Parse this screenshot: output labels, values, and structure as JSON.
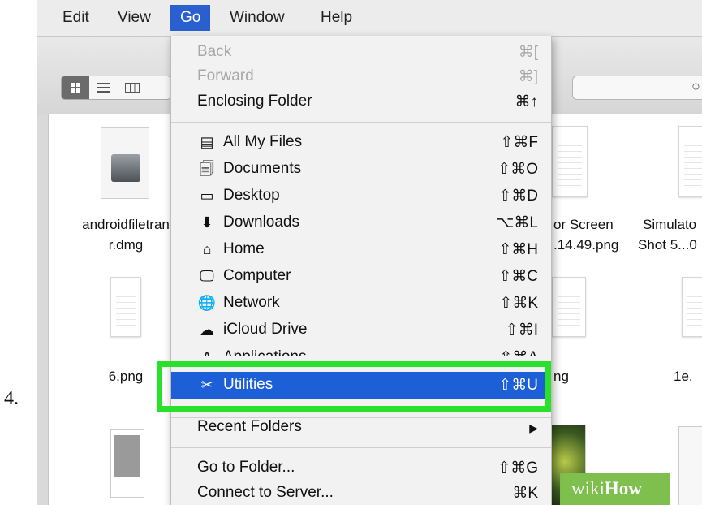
{
  "step_number": "4.",
  "menubar": {
    "items": [
      "Edit",
      "View",
      "Go",
      "Window",
      "Help"
    ],
    "active": "Go"
  },
  "toolbar": {
    "view_modes": [
      "icon-view",
      "list-view",
      "column-view"
    ],
    "search_icon": "search-icon"
  },
  "files": [
    {
      "caption_line1": "androidfiletran",
      "caption_line2": "r.dmg"
    },
    {
      "caption_line1": "or Screen",
      "caption_line2": ".14.49.png"
    },
    {
      "caption_line1": "Simulato",
      "caption_line2": "Shot 5...0"
    },
    {
      "caption_line1": "6.png",
      "caption_line2": ""
    },
    {
      "caption_line1": "ng",
      "caption_line2": ""
    },
    {
      "caption_line1": "1e.",
      "caption_line2": ""
    }
  ],
  "go_menu": {
    "back": {
      "label": "Back",
      "shortcut": "⌘["
    },
    "forward": {
      "label": "Forward",
      "shortcut": "⌘]"
    },
    "enclosing": {
      "label": "Enclosing Folder",
      "shortcut": "⌘↑"
    },
    "places": [
      {
        "label": "All My Files",
        "shortcut": "⇧⌘F",
        "icon": "all-files-icon",
        "glyph": "▤"
      },
      {
        "label": "Documents",
        "shortcut": "⇧⌘O",
        "icon": "documents-icon",
        "glyph": "🗐"
      },
      {
        "label": "Desktop",
        "shortcut": "⇧⌘D",
        "icon": "desktop-icon",
        "glyph": "▭"
      },
      {
        "label": "Downloads",
        "shortcut": "⌥⌘L",
        "icon": "downloads-icon",
        "glyph": "⬇"
      },
      {
        "label": "Home",
        "shortcut": "⇧⌘H",
        "icon": "home-icon",
        "glyph": "⌂"
      },
      {
        "label": "Computer",
        "shortcut": "⇧⌘C",
        "icon": "computer-icon",
        "glyph": "🖵"
      },
      {
        "label": "Network",
        "shortcut": "⇧⌘K",
        "icon": "network-icon",
        "glyph": "🌐"
      },
      {
        "label": "iCloud Drive",
        "shortcut": "⇧⌘I",
        "icon": "cloud-icon",
        "glyph": "☁"
      }
    ],
    "applications_partial": {
      "label": "Applications",
      "shortcut": "⇧⌘A"
    },
    "utilities": {
      "label": "Utilities",
      "shortcut": "⇧⌘U",
      "icon": "utilities-icon",
      "glyph": "✂"
    },
    "recent": {
      "label": "Recent Folders",
      "arrow": "▶"
    },
    "go_to_folder": {
      "label": "Go to Folder...",
      "shortcut": "⇧⌘G"
    },
    "connect": {
      "label": "Connect to Server...",
      "shortcut": "⌘K"
    }
  },
  "watermark": {
    "prefix": "wiki",
    "suffix": "How"
  },
  "colors": {
    "highlight": "#1c5fd7",
    "callout": "#29e02b",
    "menu_active": "#2a5fd0"
  }
}
